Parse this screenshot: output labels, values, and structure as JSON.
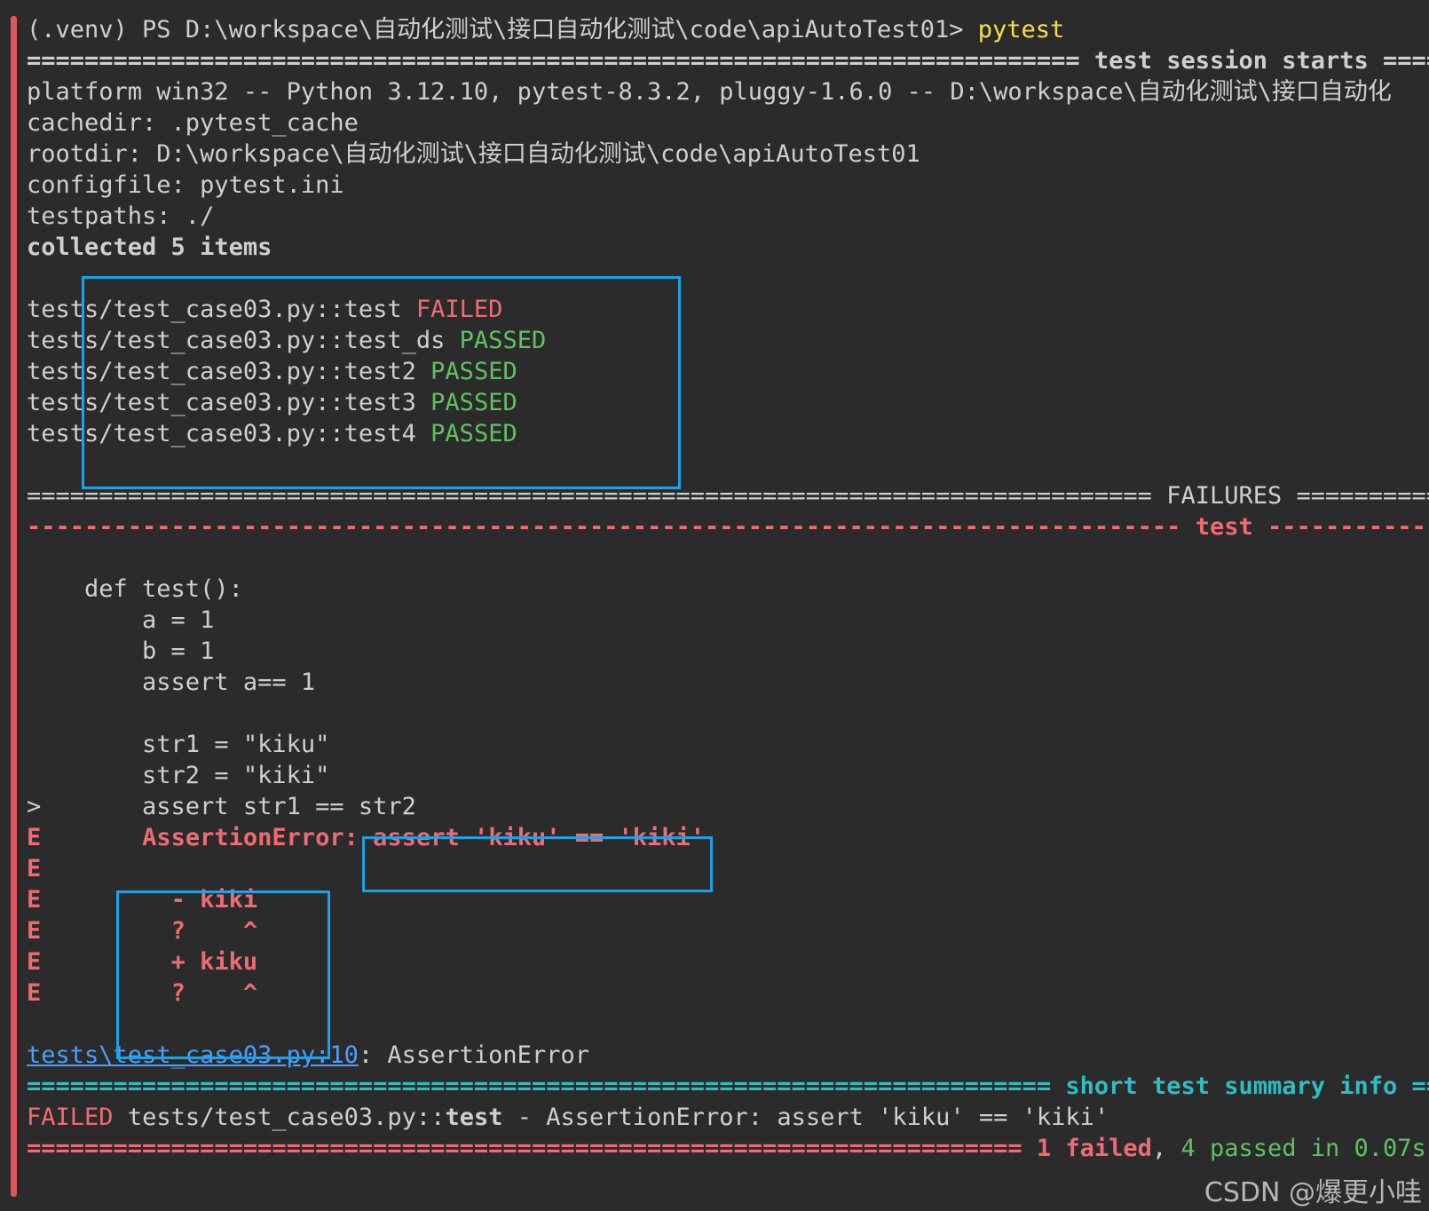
{
  "terminal": {
    "prompt": "(.venv) PS D:\\workspace\\自动化测试\\接口自动化测试\\code\\apiAutoTest01>",
    "command": "pytest",
    "session_left": "=========================================================================",
    "session_title": "test session starts",
    "session_right": "======",
    "platform": "platform win32 -- Python 3.12.10, pytest-8.3.2, pluggy-1.6.0 -- D:\\workspace\\自动化测试\\接口自动化",
    "cachedir": "cachedir: .pytest_cache",
    "rootdir": "rootdir: D:\\workspace\\自动化测试\\接口自动化测试\\code\\apiAutoTest01",
    "configfile": "configfile: pytest.ini",
    "testpaths": "testpaths: ./",
    "collected": "collected 5 items",
    "results": [
      {
        "name": "tests/test_case03.py::test",
        "status": "FAILED"
      },
      {
        "name": "tests/test_case03.py::test_ds",
        "status": "PASSED"
      },
      {
        "name": "tests/test_case03.py::test2",
        "status": "PASSED"
      },
      {
        "name": "tests/test_case03.py::test3",
        "status": "PASSED"
      },
      {
        "name": "tests/test_case03.py::test4",
        "status": "PASSED"
      }
    ],
    "failures_left": "==============================================================================",
    "failures_title": "FAILURES",
    "failures_right": "==========",
    "test_left": "--------------------------------------------------------------------------------",
    "test_title": "test",
    "test_right": "-------------",
    "code": [
      "    def test():",
      "        a = 1",
      "        b = 1",
      "        assert a== 1",
      "",
      "        str1 = \"kiku\"",
      "        str2 = \"kiki\"",
      ">       assert str1 == str2"
    ],
    "error_marker": "E",
    "error_prefix": "AssertionError:",
    "error_assert": "assert 'kiku' == 'kiki'",
    "diff": [
      "- kiki",
      "?    ^",
      "+ kiku",
      "?    ^"
    ],
    "location_link": "tests\\test_case03.py:10",
    "location_suffix": ": AssertionError",
    "summary_left": "=======================================================================",
    "summary_title": "short test summary info",
    "summary_right": "====",
    "summary_failed_label": "FAILED",
    "summary_failed_test": "tests/test_case03.py::",
    "summary_failed_testname": "test",
    "summary_failed_msg": " - AssertionError: assert 'kiku' == 'kiki'",
    "final_left": "=====================================================================",
    "final_failed": "1 failed",
    "final_sep": ",",
    "final_passed": "4 passed in 0.07s",
    "watermark": "CSDN @爆更小哇"
  },
  "colors": {
    "background": "#2b2b2b",
    "text": "#cfcfcf",
    "failed": "#ef6b73",
    "passed": "#5fc25f",
    "command": "#f3e14b",
    "summary": "#2fbdc4",
    "highlight_box": "#1aa3e8"
  }
}
